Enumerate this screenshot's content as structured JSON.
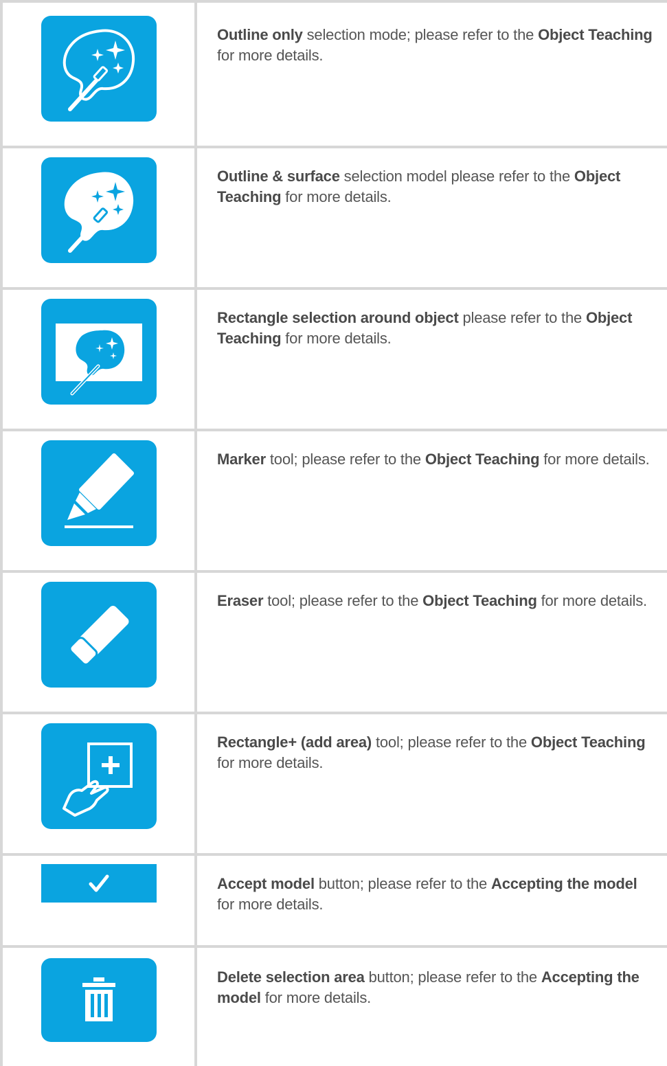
{
  "colors": {
    "icon_bg": "#0aa4e0",
    "grid": "#d7d7d7",
    "text": "#555555"
  },
  "rows": [
    {
      "icon": "outline-only-wand-icon",
      "parts": [
        {
          "t": "Outline only",
          "b": true
        },
        {
          "t": " selection mode; please refer to the ",
          "b": false
        },
        {
          "t": "Object Teaching",
          "b": true
        },
        {
          "t": " for more details.",
          "b": false
        }
      ]
    },
    {
      "icon": "outline-surface-wand-icon",
      "parts": [
        {
          "t": "Outline & surface",
          "b": true
        },
        {
          "t": " selection model please refer to the ",
          "b": false
        },
        {
          "t": "Object Teaching",
          "b": true
        },
        {
          "t": " for more details.",
          "b": false
        }
      ]
    },
    {
      "icon": "rectangle-selection-wand-icon",
      "parts": [
        {
          "t": "Rectangle selection around object",
          "b": true
        },
        {
          "t": " please refer to the ",
          "b": false
        },
        {
          "t": "Object Teaching",
          "b": true
        },
        {
          "t": " for more details.",
          "b": false
        }
      ]
    },
    {
      "icon": "marker-icon",
      "parts": [
        {
          "t": "Marker",
          "b": true
        },
        {
          "t": " tool; please refer to the ",
          "b": false
        },
        {
          "t": "Object Teaching",
          "b": true
        },
        {
          "t": " for more details.",
          "b": false
        }
      ]
    },
    {
      "icon": "eraser-icon",
      "parts": [
        {
          "t": "Eraser",
          "b": true
        },
        {
          "t": " tool; please refer to the ",
          "b": false
        },
        {
          "t": "Object Teaching",
          "b": true
        },
        {
          "t": " for more details.",
          "b": false
        }
      ]
    },
    {
      "icon": "rectangle-plus-hand-icon",
      "parts": [
        {
          "t": "Rectangle+ (add area)",
          "b": true
        },
        {
          "t": " tool; please refer to the ",
          "b": false
        },
        {
          "t": "Object Teaching",
          "b": true
        },
        {
          "t": " for more details.",
          "b": false
        }
      ]
    },
    {
      "icon": "checkmark-icon",
      "parts": [
        {
          "t": "Accept model",
          "b": true
        },
        {
          "t": " button; please refer to the ",
          "b": false
        },
        {
          "t": "Accepting the model",
          "b": true
        },
        {
          "t": " for more details.",
          "b": false
        }
      ]
    },
    {
      "icon": "trash-icon",
      "parts": [
        {
          "t": "Delete selection area",
          "b": true
        },
        {
          "t": " button; please refer to the ",
          "b": false
        },
        {
          "t": "Accepting the model",
          "b": true
        },
        {
          "t": " for more details.",
          "b": false
        }
      ]
    }
  ]
}
